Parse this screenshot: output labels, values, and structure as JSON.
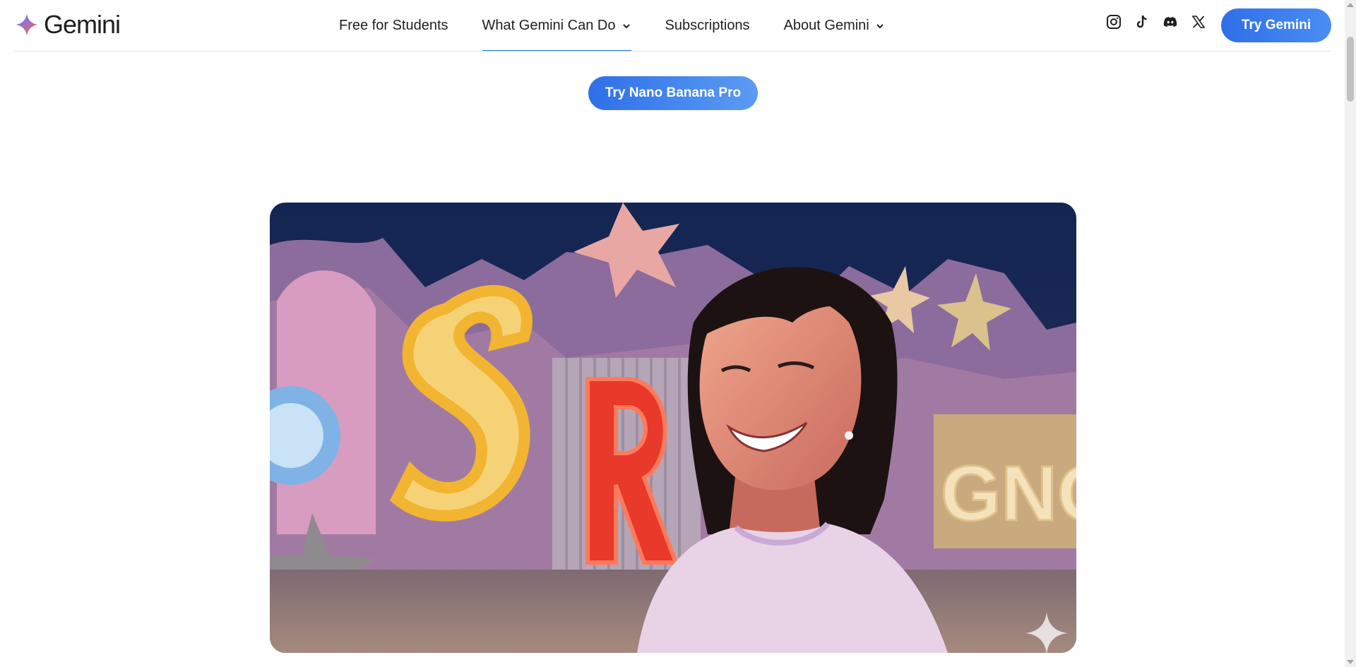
{
  "header": {
    "brand_name": "Gemini",
    "nav": [
      {
        "label": "Free for Students",
        "has_dropdown": false,
        "active": false
      },
      {
        "label": "What Gemini Can Do",
        "has_dropdown": true,
        "active": true
      },
      {
        "label": "Subscriptions",
        "has_dropdown": false,
        "active": false
      },
      {
        "label": "About Gemini",
        "has_dropdown": true,
        "active": false
      }
    ],
    "social_icons": [
      "instagram-icon",
      "tiktok-icon",
      "discord-icon",
      "x-icon"
    ],
    "cta_label": "Try Gemini"
  },
  "main": {
    "secondary_cta_label": "Try Nano Banana Pro",
    "hero_image": {
      "signs": [
        "S",
        "R",
        "O",
        "GNOON"
      ],
      "watermark_icon": "gemini-sparkle-icon"
    }
  },
  "colors": {
    "accent": "#1a73e8",
    "button_gradient_start": "#2f6fe8",
    "button_gradient_end": "#4a8df2",
    "text": "#1f1f1f"
  }
}
